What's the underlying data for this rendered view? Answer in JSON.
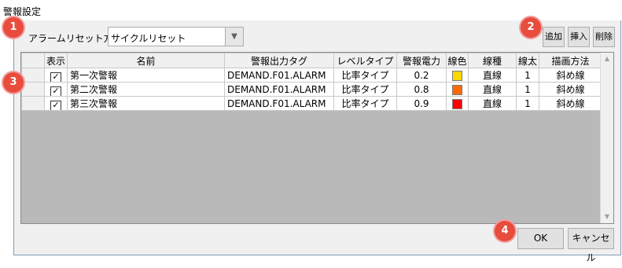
{
  "window": {
    "title": "警報設定"
  },
  "reset": {
    "label": "アラームリセット方法",
    "value": "サイクルリセット"
  },
  "toolbar": {
    "add_label": "追加",
    "insert_label": "挿入",
    "delete_label": "削除"
  },
  "badges": [
    "1",
    "2",
    "3",
    "4"
  ],
  "grid": {
    "columns": [
      "表示",
      "名前",
      "警報出力タグ",
      "レベルタイプ",
      "警報電力",
      "線色",
      "線種",
      "線太",
      "描画方法"
    ],
    "rows": [
      {
        "visible": "✓",
        "name": "第一次警報",
        "tag": "DEMAND.F01.ALARM",
        "level_type": "比率タイプ",
        "power": "0.2",
        "color": "#ffd700",
        "line_type": "直線",
        "line_width": "1",
        "draw_method": "斜め線"
      },
      {
        "visible": "✓",
        "name": "第二次警報",
        "tag": "DEMAND.F01.ALARM",
        "level_type": "比率タイプ",
        "power": "0.8",
        "color": "#ff6a00",
        "line_type": "直線",
        "line_width": "1",
        "draw_method": "斜め線"
      },
      {
        "visible": "✓",
        "name": "第三次警報",
        "tag": "DEMAND.F01.ALARM",
        "level_type": "比率タイプ",
        "power": "0.9",
        "color": "#ff0000",
        "line_type": "直線",
        "line_width": "1",
        "draw_method": "斜め線"
      }
    ]
  },
  "footer": {
    "ok_label": "OK",
    "cancel_label": "キャンセル"
  },
  "icons": {
    "dropdown": "triangle-down-icon",
    "scroll_up": "scroll-up-icon",
    "scroll_down": "scroll-down-icon",
    "check": "checkmark-icon"
  }
}
